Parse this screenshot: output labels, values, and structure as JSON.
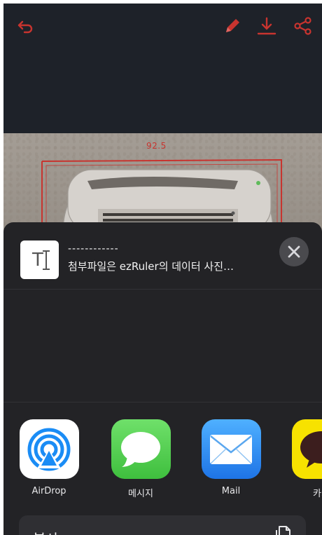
{
  "photo": {
    "measurement": "92.5"
  },
  "share_sheet": {
    "header_line1": "------------",
    "header_line2": "첨부파일은 ezRuler의 데이터 사진…",
    "apps": [
      {
        "label": "AirDrop",
        "icon": "airdrop-icon"
      },
      {
        "label": "메시지",
        "icon": "messages-icon"
      },
      {
        "label": "Mail",
        "icon": "mail-icon"
      },
      {
        "label": "카카",
        "icon": "kakaotalk-icon"
      }
    ],
    "copy_label": "복사"
  },
  "colors": {
    "accent_red": "#c8342f",
    "sheet_bg": "#232326",
    "messages_green": "#5fd25a",
    "mail_blue": "#2f8df3",
    "kakao_yellow": "#f7e200"
  }
}
